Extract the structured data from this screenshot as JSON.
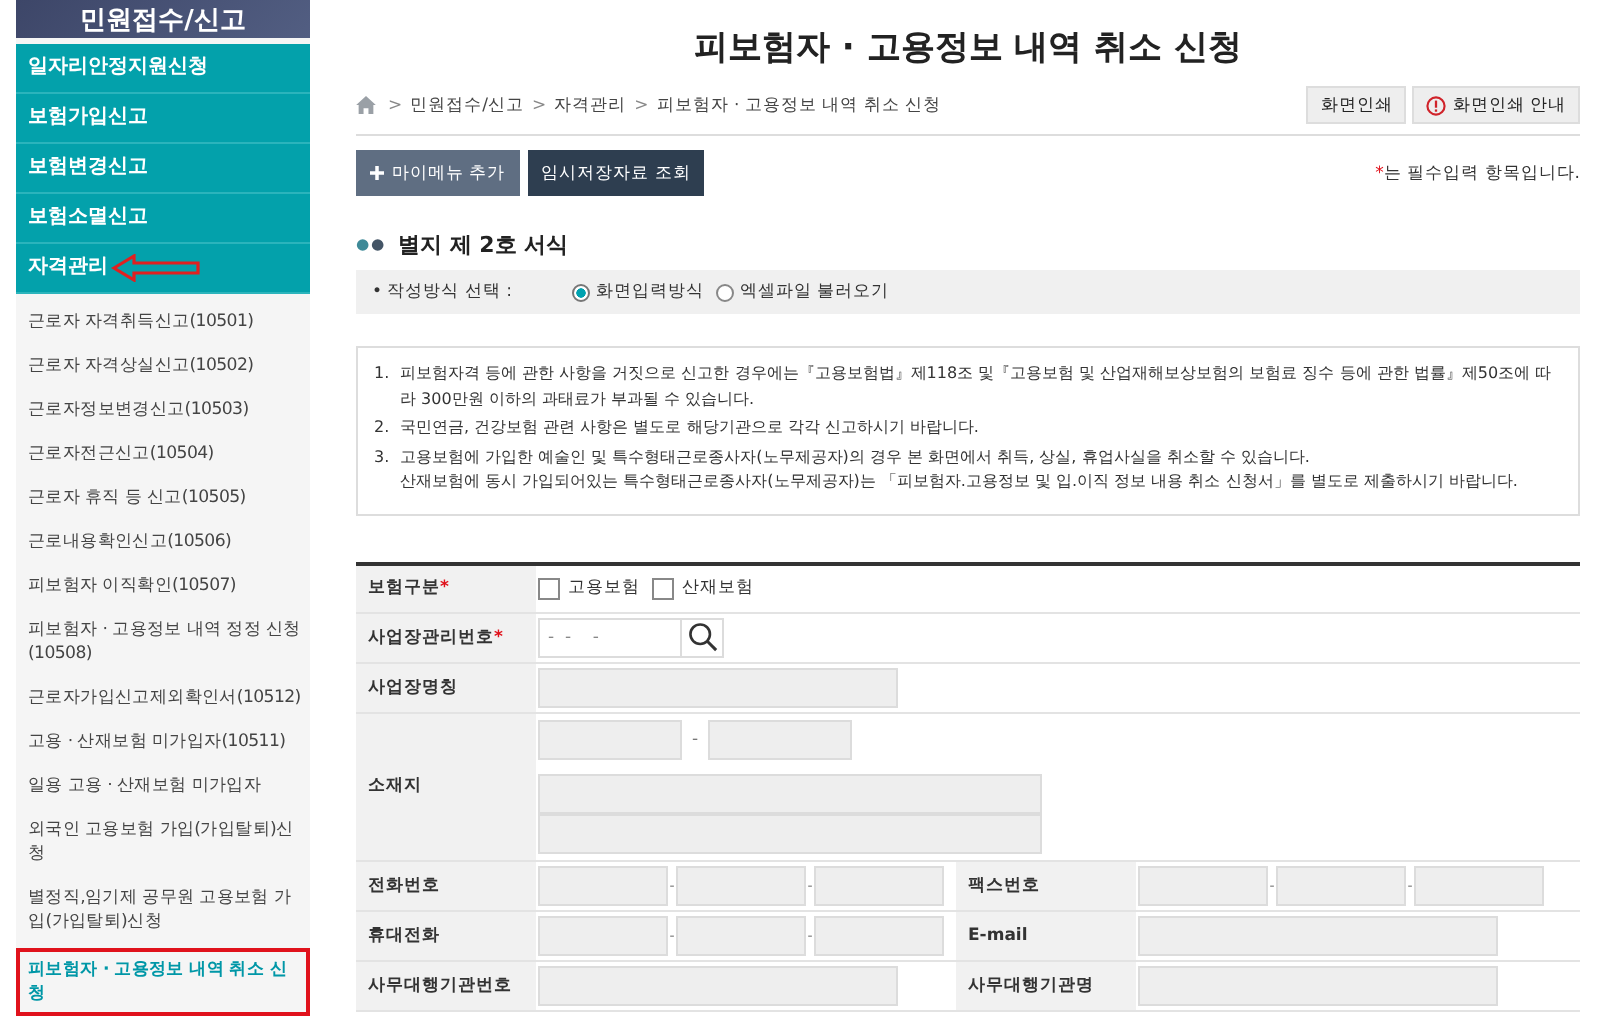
{
  "sidebar": {
    "title": "민원접수/신고",
    "sections": [
      {
        "label": "일자리안정지원신청",
        "marked": false
      },
      {
        "label": "보험가입신고",
        "marked": false
      },
      {
        "label": "보험변경신고",
        "marked": false
      },
      {
        "label": "보험소멸신고",
        "marked": false
      },
      {
        "label": "자격관리",
        "marked": true
      }
    ],
    "items": [
      {
        "label": "근로자 자격취득신고(10501)",
        "selected": false
      },
      {
        "label": "근로자 자격상실신고(10502)",
        "selected": false
      },
      {
        "label": "근로자정보변경신고(10503)",
        "selected": false
      },
      {
        "label": "근로자전근신고(10504)",
        "selected": false
      },
      {
        "label": "근로자 휴직 등 신고(10505)",
        "selected": false
      },
      {
        "label": "근로내용확인신고(10506)",
        "selected": false
      },
      {
        "label": "피보험자 이직확인(10507)",
        "selected": false
      },
      {
        "label": "피보험자 · 고용정보 내역 정정 신청(10508)",
        "selected": false
      },
      {
        "label": "근로자가입신고제외확인서(10512)",
        "selected": false
      },
      {
        "label": "고용 · 산재보험 미가입자(10511)",
        "selected": false
      },
      {
        "label": "일용 고용 · 산재보험 미가입자",
        "selected": false
      },
      {
        "label": "외국인 고용보험 가입(가입탈퇴)신청",
        "selected": false
      },
      {
        "label": "별정직,임기제 공무원 고용보험 가입(가입탈퇴)신청",
        "selected": false
      },
      {
        "label": "피보험자 · 고용정보 내역 취소 신청",
        "selected": true
      }
    ]
  },
  "page_title": "피보험자 · 고용정보 내역 취소 신청",
  "breadcrumb": [
    "민원접수/신고",
    "자격관리",
    "피보험자 · 고용정보 내역 취소 신청"
  ],
  "breadcrumb_separator": ">",
  "print_buttons": [
    {
      "label": "화면인쇄",
      "kind": "plain"
    },
    {
      "label": "화면인쇄 안내",
      "kind": "alert"
    }
  ],
  "action_buttons": [
    {
      "label": "마이메뉴 추가",
      "kind": "add"
    },
    {
      "label": "임시저장자료 조회",
      "kind": "plain"
    }
  ],
  "required_note": {
    "mark": "*",
    "text": "는 필수입력 항목입니다."
  },
  "section_title": "별지 제 2호 서식",
  "method": {
    "label": "• 작성방식 선택 :",
    "options": [
      {
        "label": "화면입력방식",
        "selected": true
      },
      {
        "label": "엑셀파일 불러오기",
        "selected": false
      }
    ]
  },
  "notes": [
    {
      "number": "1.",
      "lines": [
        "피보험자격 등에 관한 사항을 거짓으로 신고한 경우에는『고용보험법』제118조 및『고용보험 및 산업재해보상보험의 보험료 징수 등에 관한 법률』제50조에 따라 300만원 이하의 과태료가 부과될 수 있습니다."
      ]
    },
    {
      "number": "2.",
      "lines": [
        "국민연금, 건강보험 관련 사항은 별도로 해당기관으로 각각 신고하시기 바랍니다."
      ]
    },
    {
      "number": "3.",
      "lines": [
        "고용보험에 가입한 예술인 및 특수형태근로종사자(노무제공자)의 경우 본 화면에서 취득, 상실, 휴업사실을 취소할 수 있습니다.",
        "산재보험에 동시 가입되어있는 특수형태근로종사자(노무제공자)는 「피보험자.고용정보 및 입.이직 정보 내용 취소 신청서」를 별도로 제출하시기 바랍니다."
      ]
    }
  ],
  "form": [
    {
      "kind": "checks",
      "label": "보험구분",
      "required": "*",
      "options": [
        {
          "label": "고용보험",
          "checked": false
        },
        {
          "label": "산재보험",
          "checked": false
        }
      ]
    },
    {
      "kind": "search",
      "label": "사업장관리번호",
      "required": "*",
      "value": "-  -    -"
    },
    {
      "kind": "text",
      "label": "사업장명칭"
    },
    {
      "kind": "address",
      "label": "소재지",
      "separator": "-"
    },
    {
      "kind": "pair",
      "cells": [
        {
          "kind": "phone",
          "label": "전화번호",
          "separator": "-"
        },
        {
          "kind": "phone",
          "label": "팩스번호",
          "separator": "-"
        }
      ]
    },
    {
      "kind": "pair",
      "cells": [
        {
          "kind": "phone",
          "label": "휴대전화",
          "separator": "-"
        },
        {
          "kind": "text",
          "label": "E-mail"
        }
      ]
    },
    {
      "kind": "pair",
      "cells": [
        {
          "kind": "text",
          "label": "사무대행기관번호"
        },
        {
          "kind": "text",
          "label": "사무대행기관명"
        }
      ]
    }
  ]
}
